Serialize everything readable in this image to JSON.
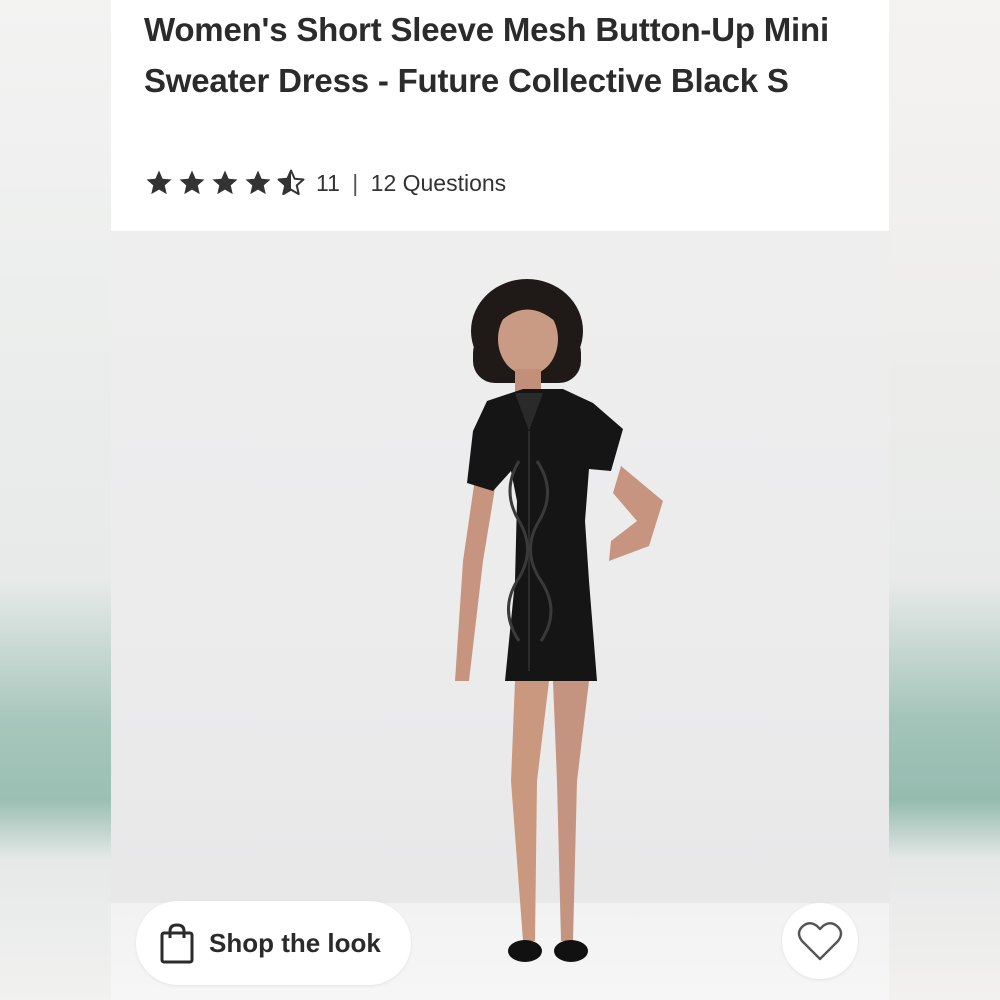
{
  "product": {
    "title": "Women's Short Sleeve Mesh Button-Up Mini Sweater Dress - Future Collective Black S",
    "rating": 4.5,
    "rating_max": 5,
    "review_count": "11",
    "separator": "|",
    "questions_label": "12 Questions"
  },
  "hero": {
    "image_subject": "model wearing black mesh button-up mini sweater dress"
  },
  "actions": {
    "shop_the_look_label": "Shop the look",
    "shop_icon": "shopping-bag-icon",
    "favorite_icon": "heart-outline-icon"
  },
  "colors": {
    "text": "#2b2b2b",
    "star": "#333333",
    "card_bg": "#ffffff",
    "hero_bg": "#ececed"
  }
}
